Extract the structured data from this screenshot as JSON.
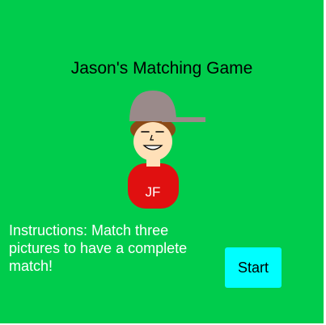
{
  "game": {
    "title": "Jason's Matching Game",
    "character": {
      "initials": "JF",
      "icon": "boy-with-cap-avatar"
    },
    "instructions": "Instructions: Match three pictures to have a complete match!",
    "start_label": "Start"
  },
  "colors": {
    "background": "#00cc4c",
    "title_text": "#000000",
    "instructions_text": "#ffffff",
    "start_button": "#00ffff",
    "cap": "#9a8a8a",
    "face": "#ffe0b8",
    "hair": "#8b4a17",
    "shirt": "#e01010"
  }
}
